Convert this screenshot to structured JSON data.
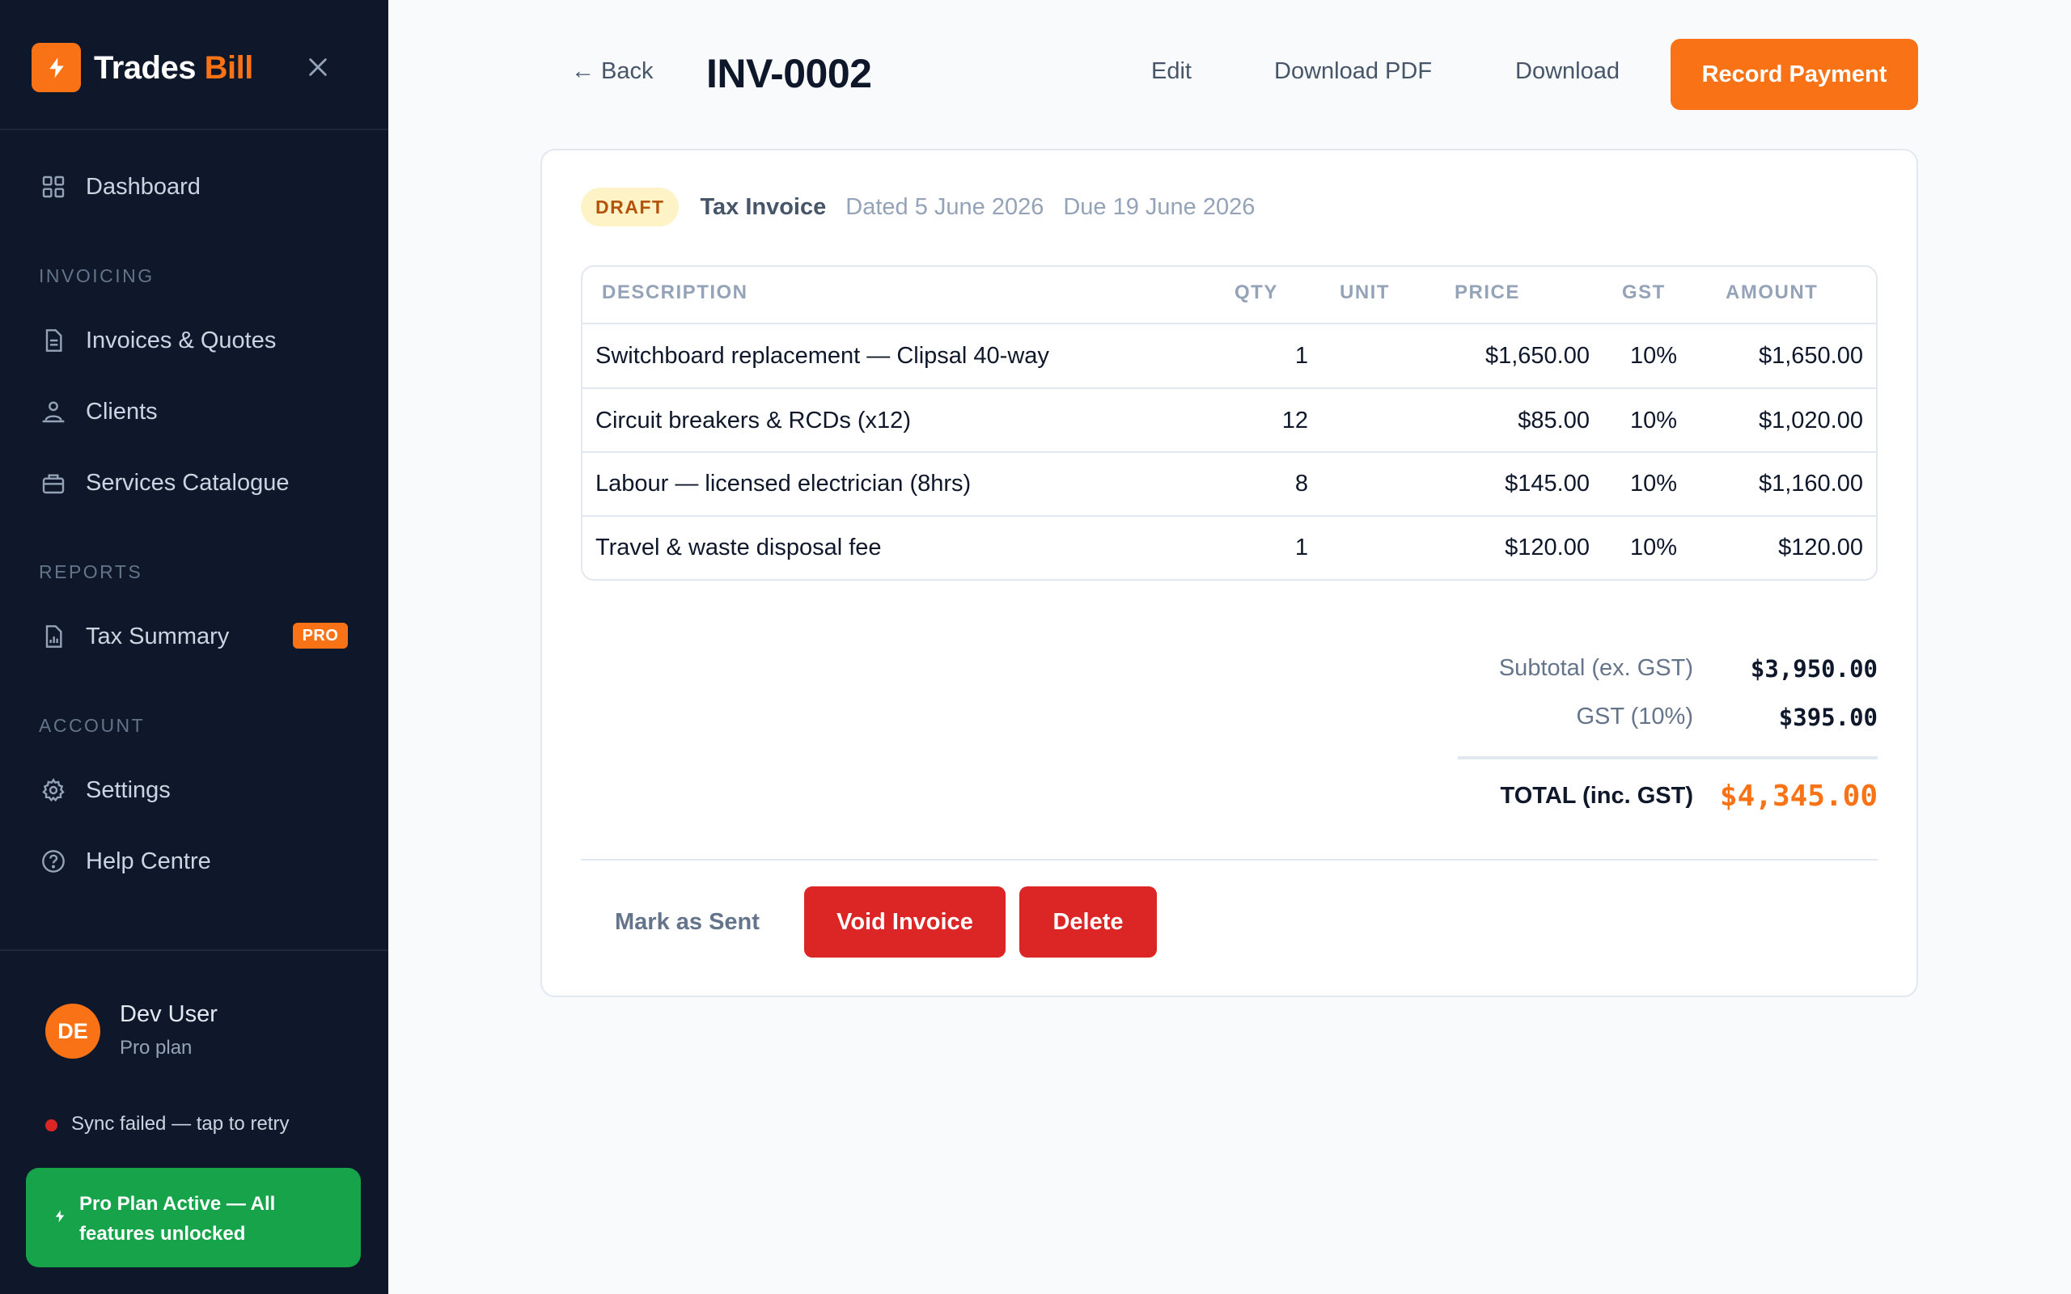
{
  "sidebar": {
    "brand": {
      "name_main": "Trades",
      "name_accent": "Bill"
    },
    "items": {
      "dashboard": "Dashboard",
      "invoices": "Invoices & Quotes",
      "clients": "Clients",
      "services": "Services Catalogue",
      "tax_summary": "Tax Summary",
      "settings": "Settings",
      "help": "Help Centre"
    },
    "sections": {
      "invoicing": "INVOICING",
      "reports": "REPORTS",
      "account": "ACCOUNT"
    },
    "pro_badge": "PRO",
    "user": {
      "initials": "DE",
      "name": "Dev User",
      "plan": "Pro plan"
    },
    "sync_status": "Sync failed — tap to retry",
    "pro_banner": "Pro Plan Active — All features unlocked"
  },
  "header": {
    "back": "← Back",
    "title": "INV-0002",
    "edit": "Edit",
    "download_pdf": "Download PDF",
    "download": "Download",
    "record_payment": "Record Payment"
  },
  "invoice": {
    "status": "DRAFT",
    "type": "Tax Invoice",
    "dated": "Dated 5 June 2026",
    "due": "Due 19 June 2026",
    "columns": {
      "description": "DESCRIPTION",
      "qty": "QTY",
      "unit": "UNIT",
      "price": "PRICE",
      "gst": "GST",
      "amount": "AMOUNT"
    },
    "items": [
      {
        "description": "Switchboard replacement — Clipsal 40-way",
        "qty": "1",
        "unit": "",
        "price": "$1,650.00",
        "gst": "10%",
        "amount": "$1,650.00"
      },
      {
        "description": "Circuit breakers & RCDs (x12)",
        "qty": "12",
        "unit": "",
        "price": "$85.00",
        "gst": "10%",
        "amount": "$1,020.00"
      },
      {
        "description": "Labour — licensed electrician (8hrs)",
        "qty": "8",
        "unit": "",
        "price": "$145.00",
        "gst": "10%",
        "amount": "$1,160.00"
      },
      {
        "description": "Travel & waste disposal fee",
        "qty": "1",
        "unit": "",
        "price": "$120.00",
        "gst": "10%",
        "amount": "$120.00"
      }
    ],
    "summary": {
      "subtotal_label": "Subtotal (ex. GST)",
      "subtotal_value": "$3,950.00",
      "gst_label": "GST (10%)",
      "gst_value": "$395.00",
      "total_label": "TOTAL (inc. GST)",
      "total_value": "$4,345.00"
    },
    "actions": {
      "mark_sent": "Mark as Sent",
      "void": "Void Invoice",
      "delete": "Delete"
    }
  },
  "colors": {
    "accent": "#f97316",
    "sidebar_bg": "#0f172a",
    "danger": "#dc2626",
    "success": "#16a34a"
  }
}
